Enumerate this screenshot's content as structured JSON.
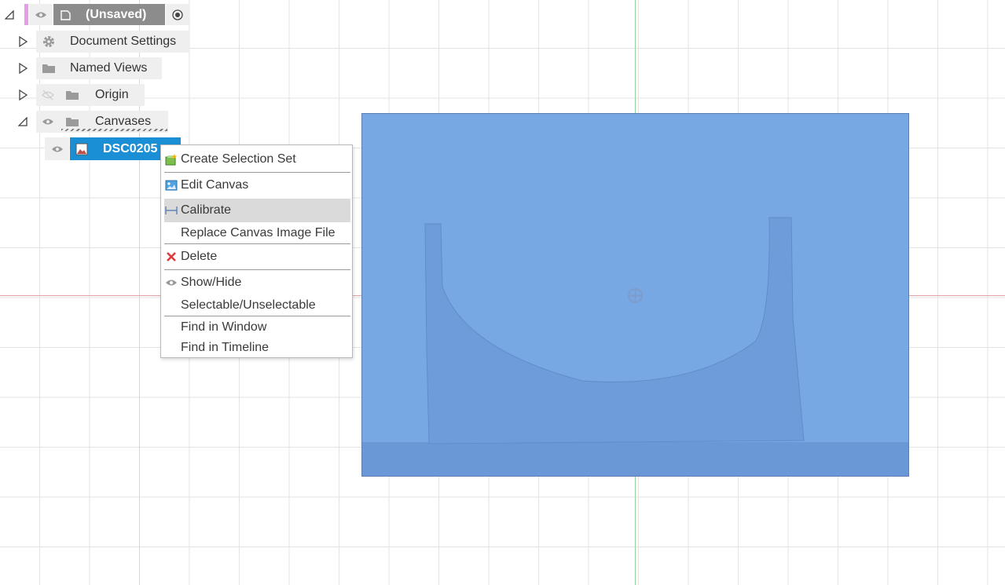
{
  "browser": {
    "root": {
      "label": "(Unsaved)"
    },
    "items": [
      {
        "label": "Document Settings"
      },
      {
        "label": "Named Views"
      },
      {
        "label": "Origin"
      },
      {
        "label": "Canvases"
      }
    ],
    "selected_canvas": {
      "label": "DSC0205"
    }
  },
  "context_menu": {
    "items": [
      {
        "label": "Create Selection Set",
        "icon": "selection-set-icon"
      },
      {
        "label": "Edit Canvas",
        "icon": "edit-canvas-icon"
      },
      {
        "label": "Calibrate",
        "icon": "calibrate-icon",
        "highlighted": true
      },
      {
        "label": "Replace Canvas Image File",
        "icon": ""
      },
      {
        "label": "Delete",
        "icon": "delete-x-icon"
      },
      {
        "label": "Show/Hide",
        "icon": "eye-icon"
      },
      {
        "label": "Selectable/Unselectable",
        "icon": ""
      },
      {
        "label": "Find in Window",
        "icon": ""
      },
      {
        "label": "Find in Timeline",
        "icon": ""
      }
    ]
  },
  "colors": {
    "selection_blue": "#1a8fd6",
    "root_gray": "#8c8c8c",
    "canvas_overlay": "#79a9e4",
    "origin_point": "#7d9ccc"
  }
}
